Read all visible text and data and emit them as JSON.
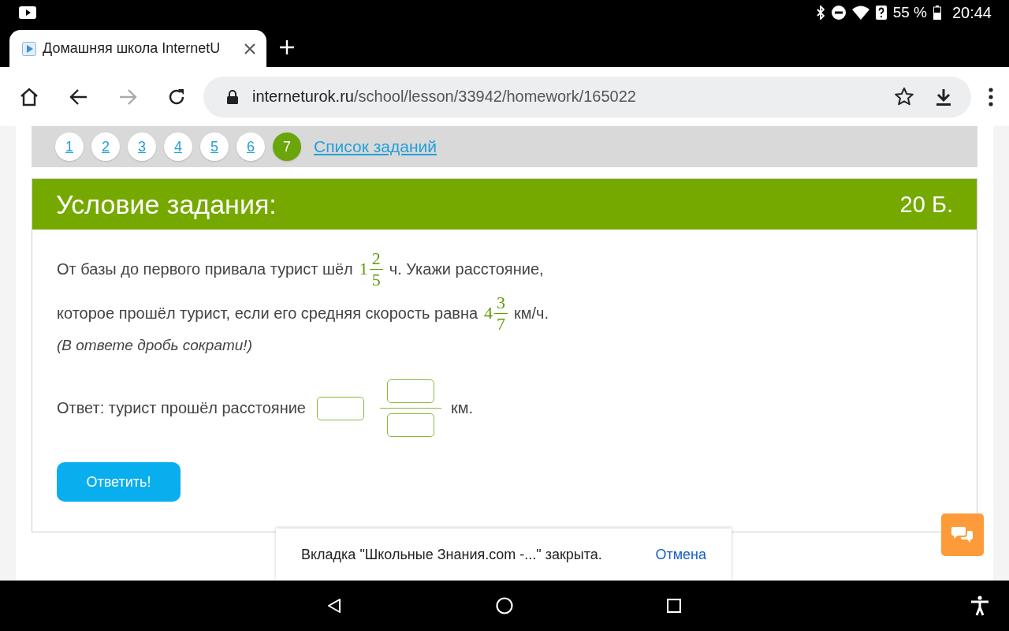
{
  "status_bar": {
    "battery": "55 %",
    "time": "20:44"
  },
  "browser": {
    "tab": {
      "title": "Домашняя школа InternetU"
    },
    "url": {
      "host": "interneturok.ru",
      "path": "/school/lesson/33942/homework/165022"
    }
  },
  "pager": {
    "items": [
      {
        "label": "1",
        "selected": false
      },
      {
        "label": "2",
        "selected": false
      },
      {
        "label": "3",
        "selected": false
      },
      {
        "label": "4",
        "selected": false
      },
      {
        "label": "5",
        "selected": false
      },
      {
        "label": "6",
        "selected": false
      },
      {
        "label": "7",
        "selected": true
      }
    ],
    "list_link": "Список заданий"
  },
  "task": {
    "title": "Условие задания:",
    "points": "20 Б.",
    "lines": [
      [
        {
          "kind": "text",
          "text": "От базы до первого привала турист шёл"
        },
        {
          "kind": "fraction",
          "whole": "1",
          "num": "2",
          "den": "5"
        },
        {
          "kind": "text",
          "text": "ч. Укажи расстояние,"
        }
      ],
      [
        {
          "kind": "text",
          "text": "которое прошёл турист, если его средняя скорость равна"
        },
        {
          "kind": "fraction",
          "whole": "4",
          "num": "3",
          "den": "7"
        },
        {
          "kind": "text",
          "text": "км/ч."
        }
      ]
    ],
    "hint": "(В ответе дробь сократи!)",
    "answer": {
      "label": "Ответ: турист прошёл расстояние",
      "unit": "км."
    },
    "submit": "Ответить!"
  },
  "snackbar": {
    "message": "Вкладка \"Школьные Знания.com -...\" закрыта.",
    "action": "Отмена"
  }
}
